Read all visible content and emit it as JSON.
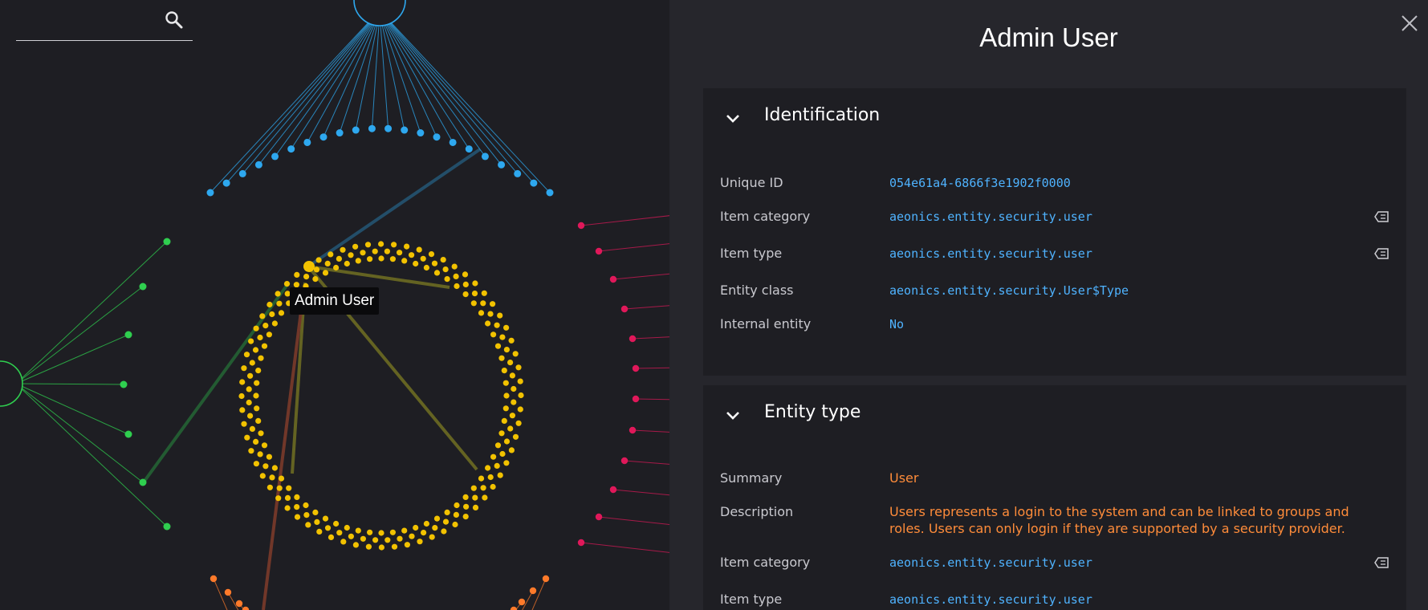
{
  "search": {
    "value": "",
    "placeholder": ""
  },
  "graph": {
    "tooltip": "Admin User",
    "colors": {
      "background": "#1e1e23",
      "blue": "#2ea8ef",
      "green": "#2fcf4f",
      "yellow": "#f2c200",
      "red": "#e0185a",
      "orange": "#ff7a2a",
      "olive": "#6b6a22",
      "brown": "#7a3a2a"
    }
  },
  "panel": {
    "title": "Admin User",
    "sections": [
      {
        "title": "Identification",
        "rows": [
          {
            "label": "Unique ID",
            "value": "054e61a4-6866f3e1902f0000"
          },
          {
            "label": "Item category",
            "value": "aeonics.entity.security.user"
          },
          {
            "label": "Item type",
            "value": "aeonics.entity.security.user"
          },
          {
            "label": "Entity class",
            "value": "aeonics.entity.security.User$Type"
          },
          {
            "label": "Internal entity",
            "value": "No"
          }
        ]
      },
      {
        "title": "Entity type",
        "rows": [
          {
            "label": "Summary",
            "value": "User"
          },
          {
            "label": "Description",
            "value": "Users represents a login to the system and can be linked to groups and roles. Users can only login if they are supported by a security provider."
          },
          {
            "label": "Item category",
            "value": "aeonics.entity.security.user"
          },
          {
            "label": "Item type",
            "value": "aeonics.entity.security.user"
          }
        ]
      }
    ]
  },
  "icons": {
    "search": "search-icon",
    "close": "close-icon",
    "chevron": "chevron-down-icon",
    "tag": "tag-icon",
    "hub_gear": "gear-icon",
    "hub_puzzle": "puzzle-icon"
  }
}
